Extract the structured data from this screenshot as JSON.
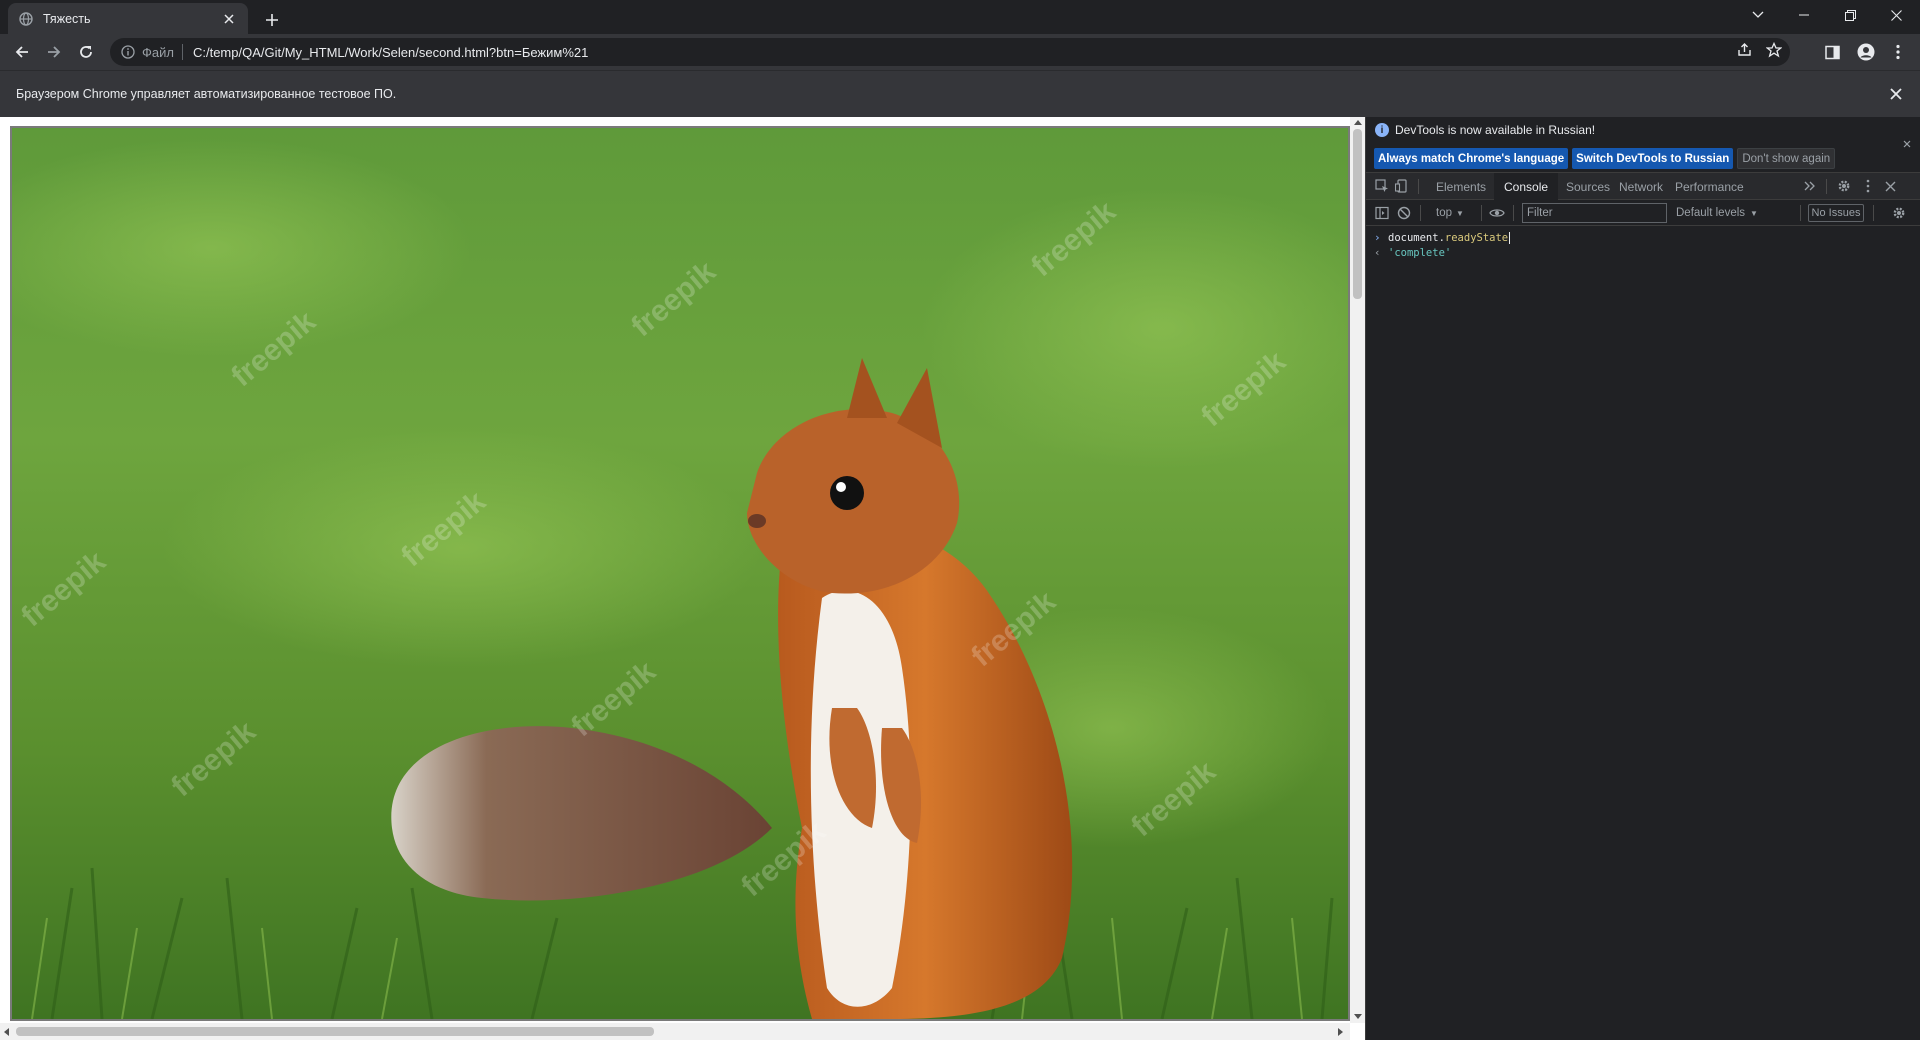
{
  "browser": {
    "tab": {
      "title": "Тяжесть",
      "favicon_icon": "globe-icon"
    },
    "window_controls": [
      "tab-search-icon",
      "minimize-icon",
      "restore-icon",
      "close-icon"
    ],
    "toolbar": {
      "back_icon": "arrow-left-icon",
      "forward_icon": "arrow-right-icon",
      "reload_icon": "reload-icon",
      "scheme_label": "Файл",
      "url": "C:/temp/QA/Git/My_HTML/Work/Selen/second.html?btn=Бежим%21",
      "right_icons": [
        "share-icon",
        "star-icon",
        "side-panel-icon",
        "profile-icon",
        "menu-icon"
      ]
    },
    "infobar": {
      "text": "Браузером Chrome управляет автоматизированное тестовое ПО."
    }
  },
  "page": {
    "image": {
      "subject": "squirrel-photo",
      "watermark": "freepik"
    }
  },
  "devtools": {
    "banner": {
      "message": "DevTools is now available in Russian!",
      "buttons": [
        "Always match Chrome's language",
        "Switch DevTools to Russian",
        "Don't show again"
      ]
    },
    "tabs": [
      "Elements",
      "Console",
      "Sources",
      "Network",
      "Performance"
    ],
    "active_tab": "Console",
    "console_toolbar": {
      "context": "top",
      "filter_placeholder": "Filter",
      "levels": "Default levels",
      "issues": "No Issues"
    },
    "console": {
      "input": {
        "object": "document.",
        "property": "readyState"
      },
      "output": "'complete'"
    },
    "colors": {
      "accent": "#1a73e8",
      "string": "#68c6c0",
      "property": "#d9c97c"
    }
  }
}
